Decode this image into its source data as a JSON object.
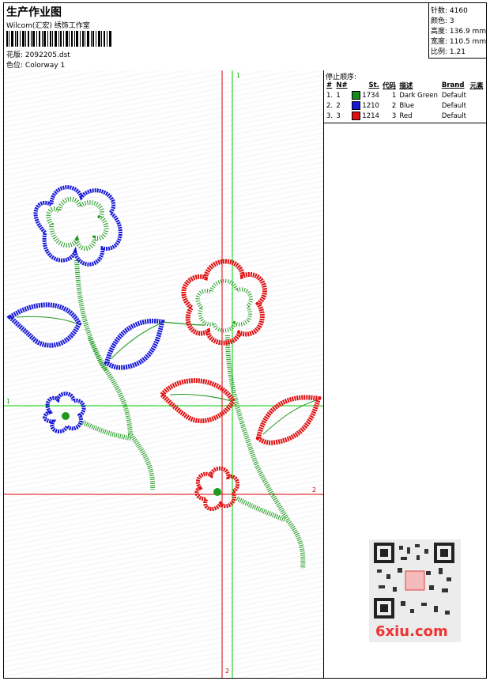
{
  "header": {
    "title": "生产作业图",
    "subtitle": "Wilcom(汇宏) 绣饰工作室",
    "pattern_label": "花版:",
    "pattern_value": "2092205.dst",
    "colorway_label": "色位:",
    "colorway_value": "Colorway 1"
  },
  "stats": [
    {
      "label": "针数:",
      "value": "4160"
    },
    {
      "label": "颜色:",
      "value": "3"
    },
    {
      "label": "高度:",
      "value": "136.9 mm"
    },
    {
      "label": "宽度:",
      "value": "110.5 mm"
    },
    {
      "label": "比例:",
      "value": "1.21"
    }
  ],
  "stop_sequence": {
    "title": "停止顺序:",
    "columns": [
      "#",
      "N#",
      "St.",
      "代码",
      "描述",
      "Brand",
      "元素"
    ],
    "rows": [
      {
        "index": "1.",
        "n": "1",
        "color": "#1a8a1a",
        "stitches": "1734",
        "code": "1",
        "description": "Dark Green",
        "brand": "Default"
      },
      {
        "index": "2.",
        "n": "2",
        "color": "#1818d8",
        "stitches": "1210",
        "code": "2",
        "description": "Blue",
        "brand": "Default"
      },
      {
        "index": "3.",
        "n": "3",
        "color": "#e01010",
        "stitches": "1214",
        "code": "3",
        "description": "Red",
        "brand": "Default"
      }
    ]
  },
  "axes": {
    "green_label_top": "1",
    "green_label_left": "1",
    "red_label_right": "2",
    "red_label_bottom": "2"
  },
  "watermark": "6xiu.com"
}
